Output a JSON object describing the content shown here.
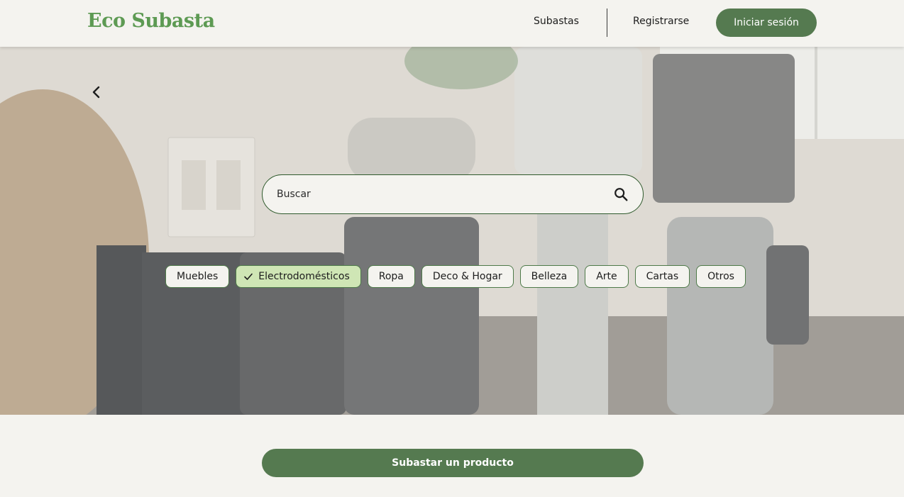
{
  "header": {
    "logo": "Eco Subasta",
    "nav": {
      "auctions": "Subastas",
      "register": "Registrarse",
      "login": "Iniciar sesión"
    }
  },
  "hero": {
    "icons": {
      "back": "chevron-left-icon",
      "search": "search-icon",
      "check": "check-icon"
    },
    "search": {
      "placeholder": "Buscar",
      "value": ""
    },
    "categories": [
      {
        "label": "Muebles",
        "selected": false
      },
      {
        "label": "Electrodomésticos",
        "selected": true
      },
      {
        "label": "Ropa",
        "selected": false
      },
      {
        "label": "Deco & Hogar",
        "selected": false
      },
      {
        "label": "Belleza",
        "selected": false
      },
      {
        "label": "Arte",
        "selected": false
      },
      {
        "label": "Cartas",
        "selected": false
      },
      {
        "label": "Otros",
        "selected": false
      }
    ]
  },
  "cta": {
    "label": "Subastar un producto"
  },
  "colors": {
    "brand": "#557a50",
    "logo": "#5d9a53",
    "chip_selected": "#cfe6b5",
    "background": "#f4f3ef"
  }
}
